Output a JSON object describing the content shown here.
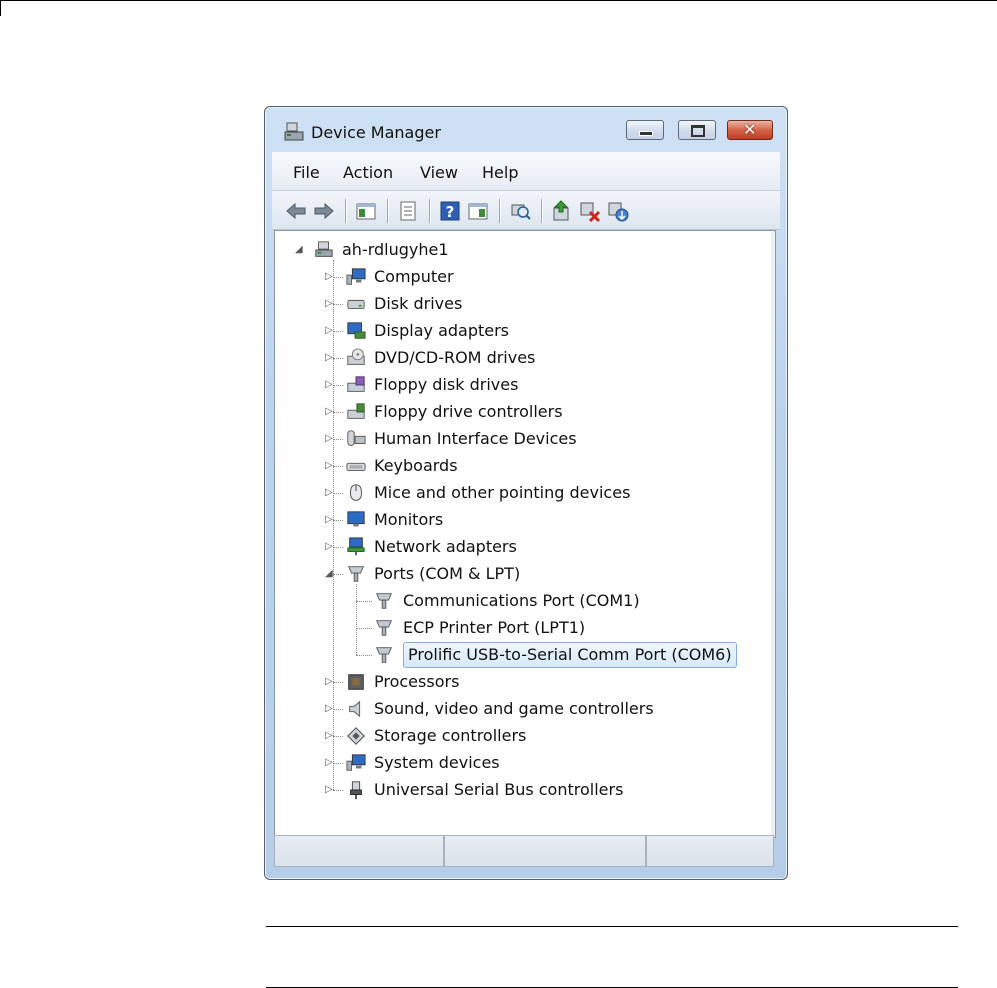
{
  "window": {
    "title": "Device Manager"
  },
  "menu": [
    "File",
    "Action",
    "View",
    "Help"
  ],
  "tree": {
    "root": "ah-rdlugyhe1",
    "categories": [
      {
        "label": "Computer",
        "icon": "computer-icon",
        "expanded": false
      },
      {
        "label": "Disk drives",
        "icon": "disk-drive-icon",
        "expanded": false
      },
      {
        "label": "Display adapters",
        "icon": "display-adapter-icon",
        "expanded": false
      },
      {
        "label": "DVD/CD-ROM drives",
        "icon": "dvd-drive-icon",
        "expanded": false
      },
      {
        "label": "Floppy disk drives",
        "icon": "floppy-drive-icon",
        "expanded": false
      },
      {
        "label": "Floppy drive controllers",
        "icon": "floppy-controller-icon",
        "expanded": false
      },
      {
        "label": "Human Interface Devices",
        "icon": "hid-icon",
        "expanded": false
      },
      {
        "label": "Keyboards",
        "icon": "keyboard-icon",
        "expanded": false
      },
      {
        "label": "Mice and other pointing devices",
        "icon": "mouse-icon",
        "expanded": false
      },
      {
        "label": "Monitors",
        "icon": "monitor-icon",
        "expanded": false
      },
      {
        "label": "Network adapters",
        "icon": "network-adapter-icon",
        "expanded": false
      },
      {
        "label": "Ports (COM & LPT)",
        "icon": "port-icon",
        "expanded": true,
        "children": [
          {
            "label": "Communications Port (COM1)",
            "selected": false
          },
          {
            "label": "ECP Printer Port (LPT1)",
            "selected": false
          },
          {
            "label": "Prolific USB-to-Serial Comm Port (COM6)",
            "selected": true
          }
        ]
      },
      {
        "label": "Processors",
        "icon": "processor-icon",
        "expanded": false
      },
      {
        "label": "Sound, video and game controllers",
        "icon": "speaker-icon",
        "expanded": false
      },
      {
        "label": "Storage controllers",
        "icon": "storage-controller-icon",
        "expanded": false
      },
      {
        "label": "System devices",
        "icon": "system-devices-icon",
        "expanded": false
      },
      {
        "label": "Universal Serial Bus controllers",
        "icon": "usb-icon",
        "expanded": false
      }
    ]
  },
  "colors": {
    "selection_border": "#84acdd",
    "titlebar": "#bcd3ec",
    "close_button": "#c13b22"
  }
}
